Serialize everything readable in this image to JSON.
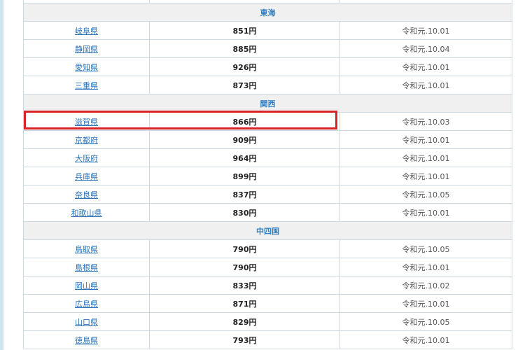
{
  "regions": [
    {
      "name": "東海",
      "rows": [
        {
          "prefecture": "岐阜県",
          "wage": "851円",
          "date": "令和元.10.01"
        },
        {
          "prefecture": "静岡県",
          "wage": "885円",
          "date": "令和元.10.04"
        },
        {
          "prefecture": "愛知県",
          "wage": "926円",
          "date": "令和元.10.01"
        },
        {
          "prefecture": "三重県",
          "wage": "873円",
          "date": "令和元.10.01"
        }
      ]
    },
    {
      "name": "関西",
      "rows": [
        {
          "prefecture": "滋賀県",
          "wage": "866円",
          "date": "令和元.10.03"
        },
        {
          "prefecture": "京都府",
          "wage": "909円",
          "date": "令和元.10.01"
        },
        {
          "prefecture": "大阪府",
          "wage": "964円",
          "date": "令和元.10.01"
        },
        {
          "prefecture": "兵庫県",
          "wage": "899円",
          "date": "令和元.10.01"
        },
        {
          "prefecture": "奈良県",
          "wage": "837円",
          "date": "令和元.10.05"
        },
        {
          "prefecture": "和歌山県",
          "wage": "830円",
          "date": "令和元.10.01"
        }
      ]
    },
    {
      "name": "中四国",
      "rows": [
        {
          "prefecture": "鳥取県",
          "wage": "790円",
          "date": "令和元.10.05"
        },
        {
          "prefecture": "島根県",
          "wage": "790円",
          "date": "令和元.10.01"
        },
        {
          "prefecture": "岡山県",
          "wage": "833円",
          "date": "令和元.10.02"
        },
        {
          "prefecture": "広島県",
          "wage": "871円",
          "date": "令和元.10.01"
        },
        {
          "prefecture": "山口県",
          "wage": "829円",
          "date": "令和元.10.05"
        },
        {
          "prefecture": "徳島県",
          "wage": "793円",
          "date": "令和元.10.01"
        }
      ]
    }
  ],
  "highlighted_prefecture": "滋賀県",
  "colors": {
    "highlight_border": "#d8232a",
    "link": "#2a73b8",
    "region_header_text": "#2f7fc1"
  }
}
